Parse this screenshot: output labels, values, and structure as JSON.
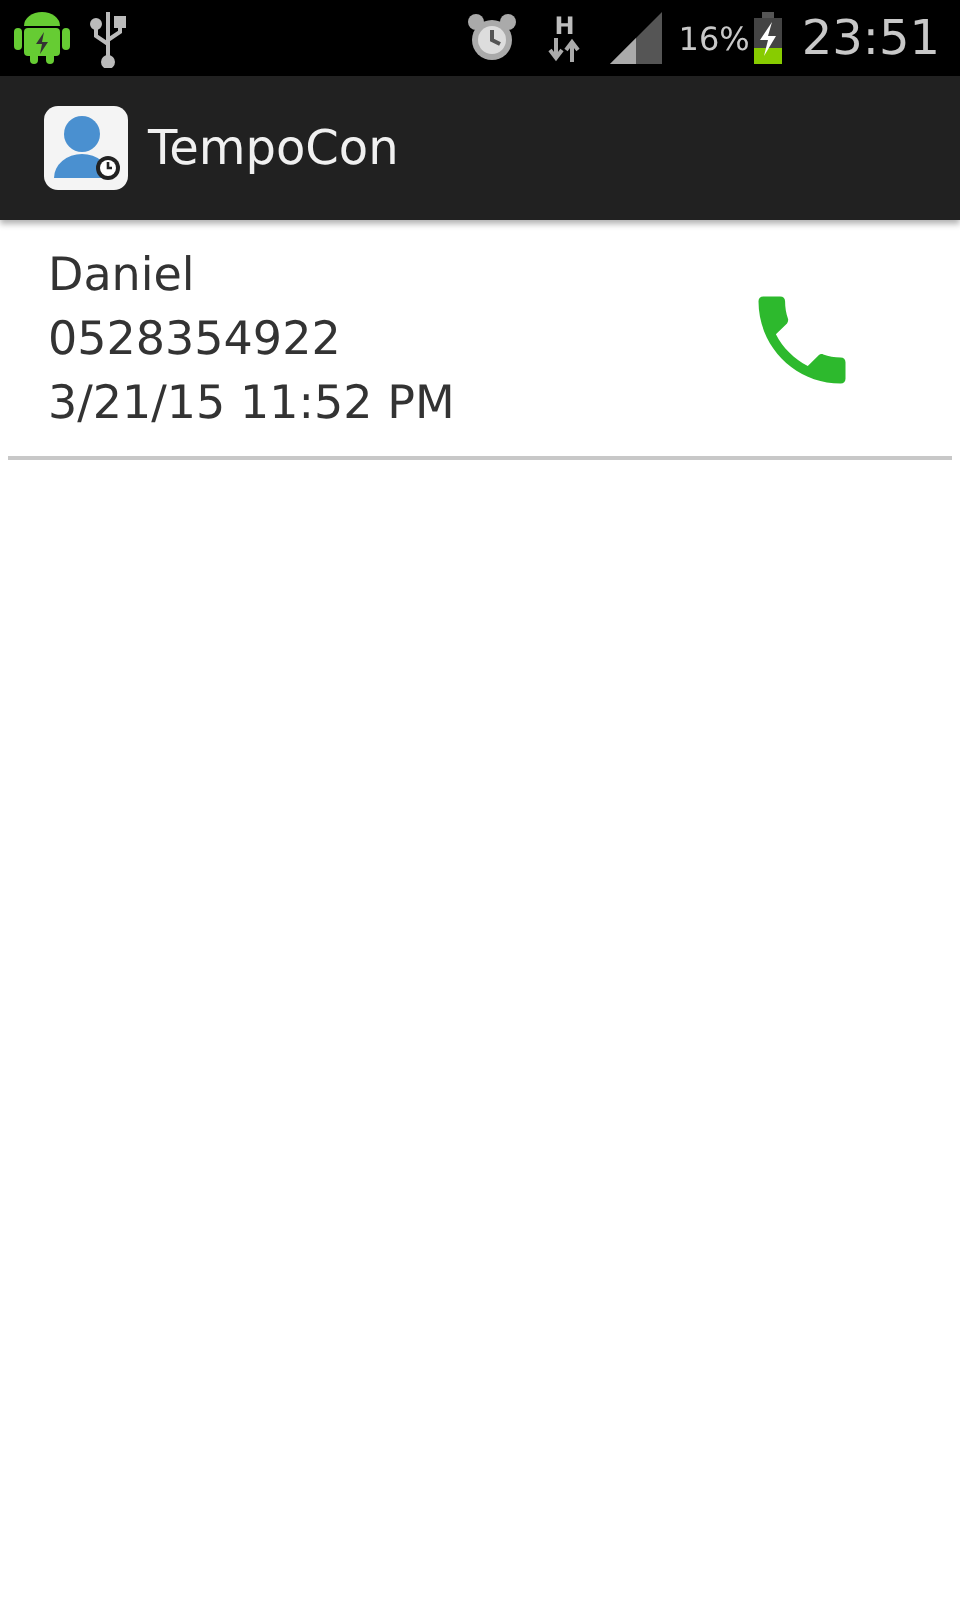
{
  "status_bar": {
    "battery_percent": "16%",
    "time": "23:51",
    "data_type": "H"
  },
  "action_bar": {
    "title": "TempoCon"
  },
  "calls": [
    {
      "name": "Daniel",
      "number": "0528354922",
      "datetime": "3/21/15 11:52 PM"
    }
  ]
}
